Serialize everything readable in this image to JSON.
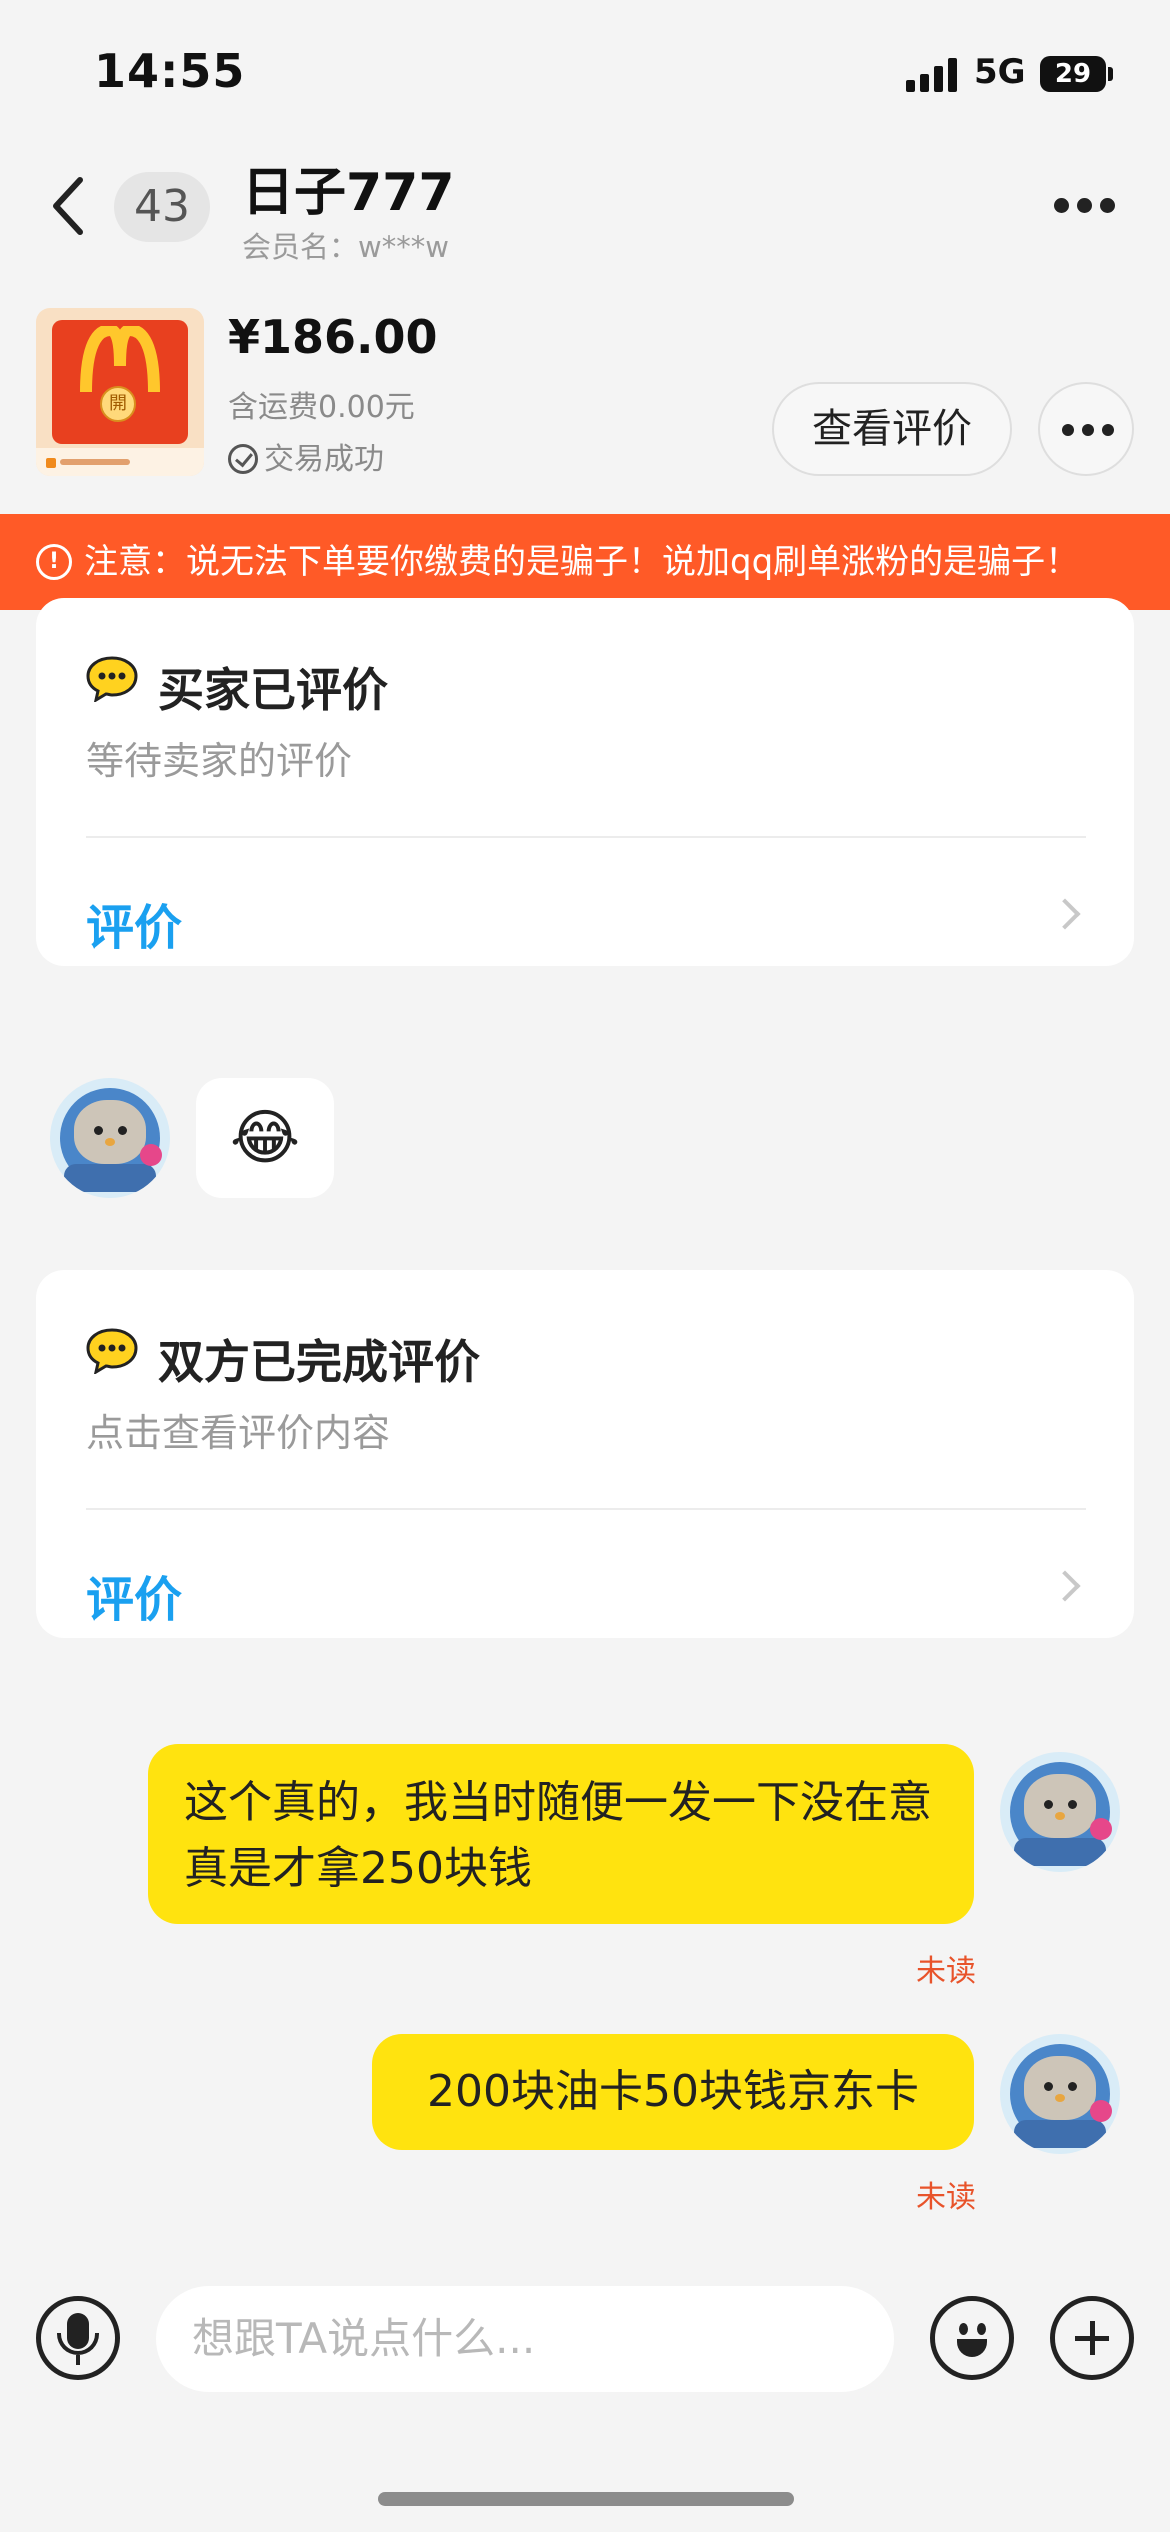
{
  "status_bar": {
    "time": "14:55",
    "network": "5G",
    "battery": "29"
  },
  "nav": {
    "unread_count": "43",
    "title": "日子777",
    "member_label": "会员名：w***w"
  },
  "product": {
    "price": "¥186.00",
    "shipping": "含运费0.00元",
    "status": "交易成功",
    "image_seal": "開",
    "view_review_button": "查看评价"
  },
  "warning": {
    "text": "注意：说无法下单要你缴费的是骗子！说加qq刷单涨粉的是骗子！"
  },
  "cards": [
    {
      "title": "买家已评价",
      "subtitle": "等待卖家的评价",
      "link": "评价"
    },
    {
      "title": "双方已完成评价",
      "subtitle": "点击查看评价内容",
      "link": "评价"
    }
  ],
  "emoji_message": "😂",
  "messages": [
    {
      "text": "这个真的，我当时随便一发一下没在意真是才拿250块钱",
      "status": "未读"
    },
    {
      "text": "200块油卡50块钱京东卡",
      "status": "未读"
    }
  ],
  "input": {
    "placeholder": "想跟TA说点什么..."
  },
  "colors": {
    "warning_bg": "#ff5a27",
    "bubble": "#ffe30f",
    "link": "#1aa0f0",
    "unread": "#e8532a"
  },
  "icons": [
    "back-icon",
    "more-icon",
    "check-circle-icon",
    "warning-icon",
    "chat-bubble-icon",
    "chevron-right-icon",
    "microphone-icon",
    "emoji-icon",
    "plus-icon"
  ]
}
